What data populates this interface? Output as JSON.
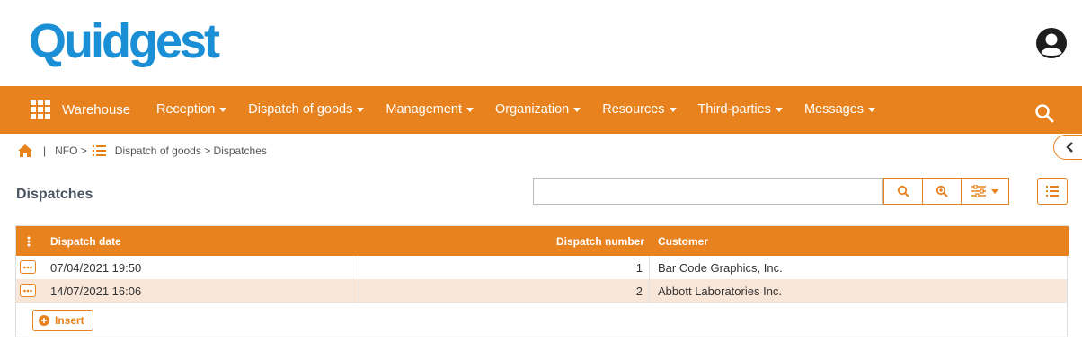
{
  "header": {
    "logo_text": "Quidgest"
  },
  "nav": {
    "brand": "Warehouse",
    "items": [
      {
        "label": "Reception"
      },
      {
        "label": "Dispatch of goods"
      },
      {
        "label": "Management"
      },
      {
        "label": "Organization"
      },
      {
        "label": "Resources"
      },
      {
        "label": "Third-parties"
      },
      {
        "label": "Messages"
      }
    ]
  },
  "breadcrumb": {
    "separator": "|",
    "first": "NFO >",
    "second": "Dispatch of goods > Dispatches"
  },
  "page": {
    "title": "Dispatches"
  },
  "search": {
    "value": "",
    "placeholder": ""
  },
  "table": {
    "columns": [
      "Dispatch date",
      "Dispatch number",
      "Customer"
    ],
    "rows": [
      {
        "date": "07/04/2021 19:50",
        "number": "1",
        "customer": "Bar Code Graphics, Inc."
      },
      {
        "date": "14/07/2021 16:06",
        "number": "2",
        "customer": "Abbott Laboratories Inc."
      }
    ],
    "insert_label": "Insert"
  },
  "colors": {
    "accent": "#e8821e",
    "logo": "#1a8fd6",
    "row_alt": "#f8e6d8"
  }
}
